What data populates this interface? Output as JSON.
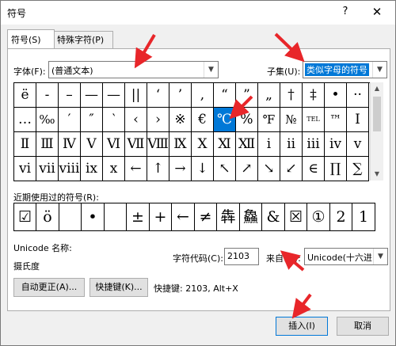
{
  "window": {
    "title": "符号",
    "help": "?",
    "close": "✕"
  },
  "tabs": [
    {
      "label": "符号(S)"
    },
    {
      "label": "特殊字符(P)"
    }
  ],
  "font": {
    "label": "字体(F):",
    "value": "(普通文本)"
  },
  "subset": {
    "label": "子集(U):",
    "value": "类似字母的符号"
  },
  "symbols": [
    [
      "ë",
      "-",
      "–",
      "—",
      "—",
      "||",
      "‘",
      "’",
      ",",
      "“",
      "”",
      "„",
      "†",
      "‡",
      "•",
      "··"
    ],
    [
      "…",
      "‰",
      "′",
      "″",
      "‵",
      "‹",
      "›",
      "※",
      "€",
      "℃",
      "%",
      "℉",
      "№",
      "TEL",
      "™",
      "I"
    ],
    [
      "Ⅱ",
      "Ⅲ",
      "Ⅳ",
      "Ⅴ",
      "Ⅵ",
      "Ⅶ",
      "Ⅷ",
      "Ⅸ",
      "Ⅹ",
      "Ⅺ",
      "Ⅻ",
      "ⅰ",
      "ⅱ",
      "ⅲ",
      "ⅳ",
      "ⅴ"
    ],
    [
      "ⅵ",
      "ⅶ",
      "ⅷ",
      "ⅸ",
      "ⅹ",
      "←",
      "↑",
      "→",
      "↓",
      "↖",
      "↗",
      "↘",
      "↙",
      "∈",
      "∏",
      "∑"
    ]
  ],
  "recent": {
    "label": "近期使用过的符号(R):",
    "symbols": [
      "☑",
      "ö",
      "",
      "•",
      "",
      "±",
      "+",
      "←",
      "≠",
      "犇",
      "鱻",
      "&",
      "☒",
      "①",
      "2",
      "1"
    ]
  },
  "unicode_name": {
    "label": "Unicode 名称:",
    "value": "摄氏度"
  },
  "char_code": {
    "label": "字符代码(C):",
    "value": "2103"
  },
  "from": {
    "label": "来自(M):",
    "value": "Unicode(十六进"
  },
  "buttons": {
    "autocorrect": "自动更正(A)...",
    "shortcut_key": "快捷键(K)...",
    "insert": "插入(I)",
    "cancel": "取消"
  },
  "shortcut": {
    "text": "快捷键: 2103, Alt+X"
  },
  "colors": {
    "selection": "#0078d7",
    "annotation_arrow": "#e8262a"
  }
}
